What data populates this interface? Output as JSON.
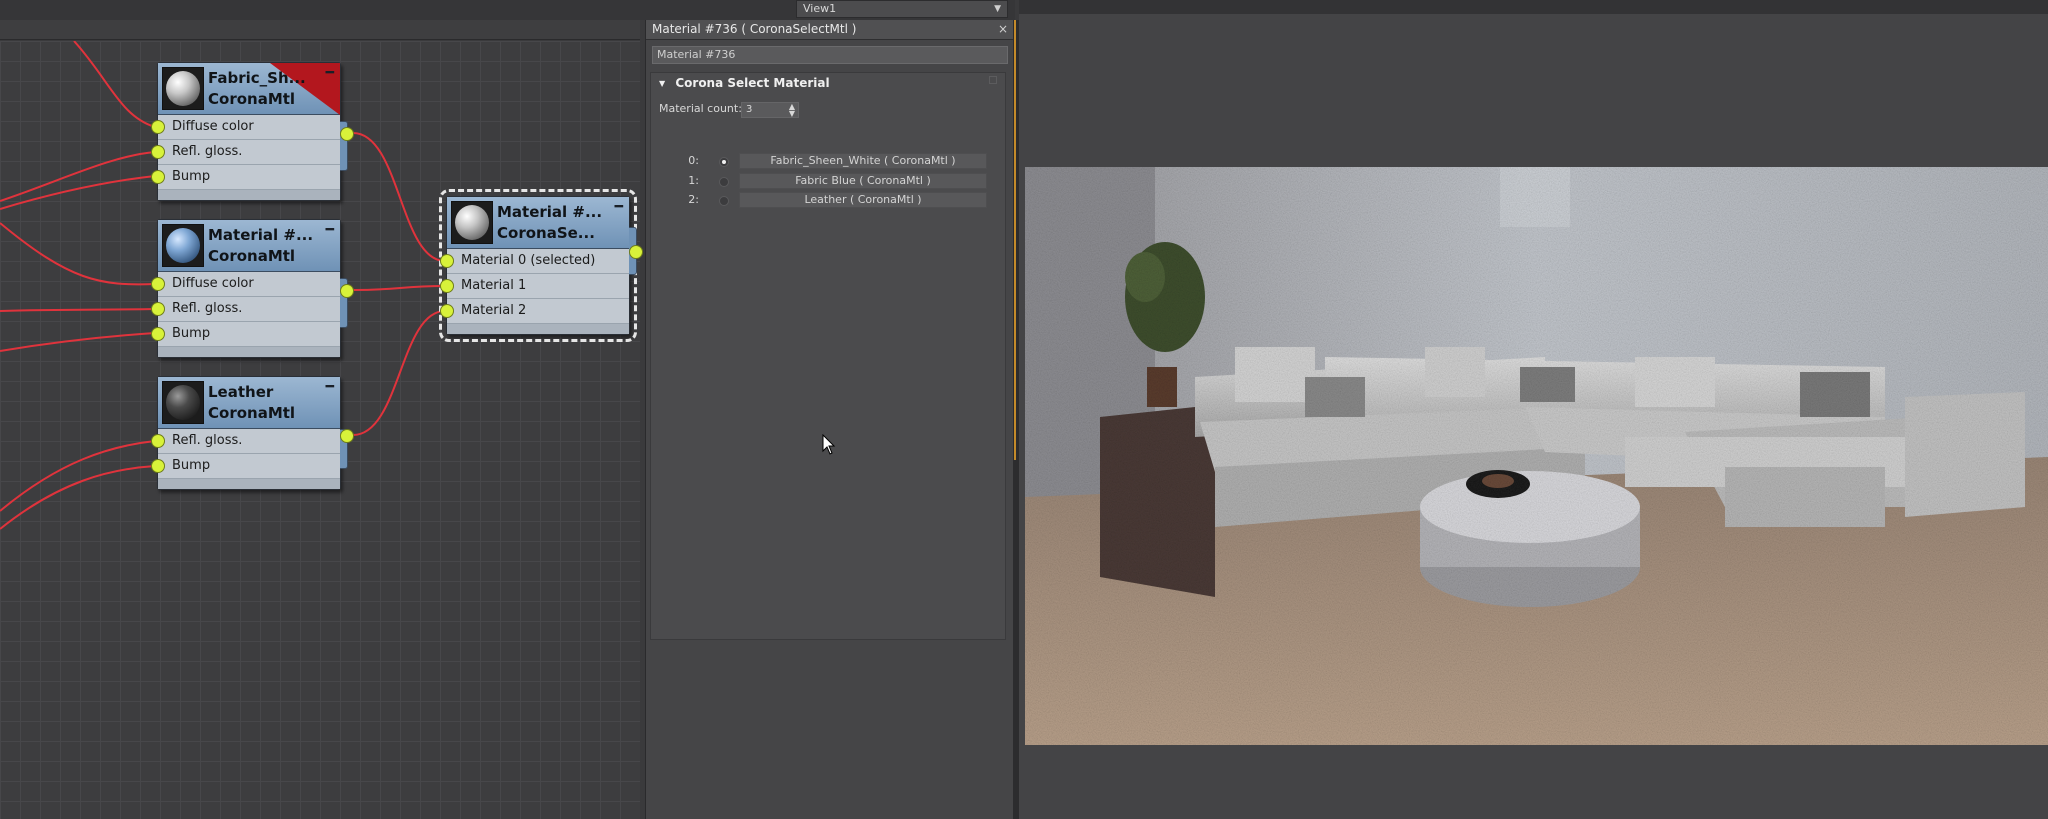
{
  "viewport_menu": {
    "label": "View1"
  },
  "nodes": {
    "fabric_sheen": {
      "title_line1": "Fabric_Sh...",
      "title_line2": "CoronaMtl",
      "inputs": [
        "Diffuse color",
        "Refl. gloss.",
        "Bump"
      ]
    },
    "material_blue": {
      "title_line1": "Material #...",
      "title_line2": "CoronaMtl",
      "inputs": [
        "Diffuse color",
        "Refl. gloss.",
        "Bump"
      ]
    },
    "leather": {
      "title_line1": "Leather",
      "title_line2": "CoronaMtl",
      "inputs": [
        "Refl. gloss.",
        "Bump"
      ]
    },
    "select": {
      "title_line1": "Material #...",
      "title_line2": "CoronaSe...",
      "inputs": [
        "Material 0 (selected)",
        "Material 1",
        "Material 2"
      ]
    }
  },
  "panel": {
    "title": "Material #736  ( CoronaSelectMtl )",
    "name_value": "Material #736",
    "rollout_title": "Corona Select Material",
    "count_label": "Material count:",
    "count_value": "3",
    "materials": [
      {
        "index": "0:",
        "label": "Fabric_Sheen_White  ( CoronaMtl )",
        "selected": true
      },
      {
        "index": "1:",
        "label": "Fabric Blue  ( CoronaMtl )",
        "selected": false
      },
      {
        "index": "2:",
        "label": "Leather  ( CoronaMtl )",
        "selected": false
      }
    ]
  },
  "colors": {
    "socket": "#d8f23a",
    "wire": "#e0333c",
    "node_header": "#7da0c4",
    "accent": "#c48a2a"
  }
}
